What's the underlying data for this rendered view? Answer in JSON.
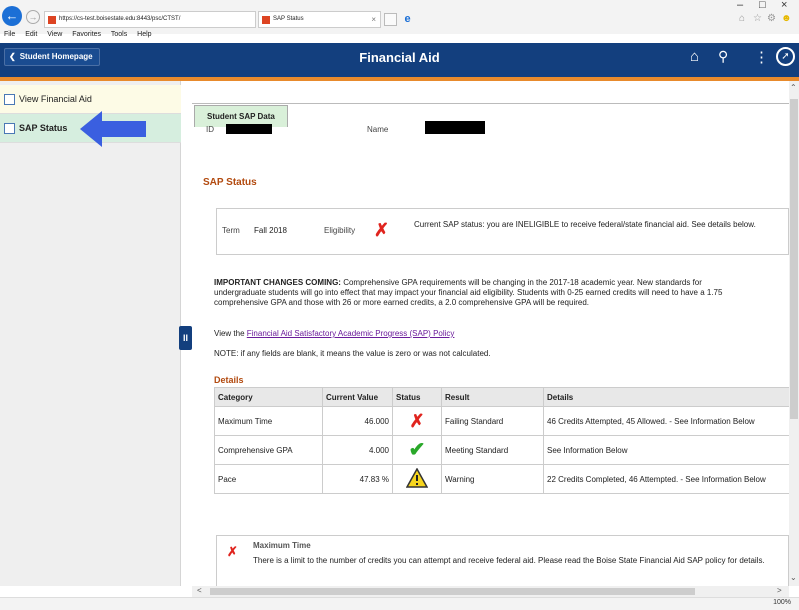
{
  "browser": {
    "address": "https://cs-test.boisestate.edu:8443/psc/CTST/",
    "tab_title": "SAP Status",
    "menu": [
      "File",
      "Edit",
      "View",
      "Favorites",
      "Tools",
      "Help"
    ],
    "zoom": "100%"
  },
  "header": {
    "home_label": "Student Homepage",
    "title": "Financial Aid",
    "icons": [
      "home-icon",
      "search-icon",
      "more-options-icon",
      "navbar-icon"
    ],
    "accent_color": "#133f7e",
    "stripe_color": "#e88a2c"
  },
  "sidebar": {
    "items": [
      {
        "label": "View Financial Aid",
        "selected": false
      },
      {
        "label": "SAP Status",
        "selected": true
      }
    ]
  },
  "content": {
    "tab_label": "Student SAP Data",
    "id_label": "ID",
    "name_label": "Name",
    "sap_heading": "SAP Status",
    "term_label": "Term",
    "term_value": "Fall 2018",
    "eligibility_label": "Eligibility",
    "status_message": "Current SAP status: you are INELIGIBLE to receive federal/state financial aid.   See details below.",
    "changes_bold": "IMPORTANT CHANGES COMING:",
    "changes_text": " Comprehensive GPA requirements will be changing in the 2017-18 academic year. New standards for undergraduate students will go into effect that may impact your financial aid eligibility. Students with 0-25 earned credits will need to have a 1.75 comprehensive GPA and those with 26 or more earned credits, a 2.0 comprehensive GPA will be required.",
    "policy_prefix": "View the ",
    "policy_link": "Financial Aid Satisfactory Academic Progress (SAP) Policy",
    "note": "NOTE: if any fields are blank, it means the value is zero or was not calculated.",
    "details_heading": "Details",
    "table": {
      "headers": [
        "Category",
        "Current Value",
        "Status",
        "Result",
        "Details"
      ],
      "rows": [
        {
          "category": "Maximum Time",
          "value": "46.000",
          "status": "fail",
          "result": "Failing Standard",
          "details": "46 Credits Attempted, 45 Allowed. - See Information Below"
        },
        {
          "category": "Comprehensive GPA",
          "value": "4.000",
          "status": "pass",
          "result": "Meeting Standard",
          "details": "See Information Below"
        },
        {
          "category": "Pace",
          "value": "47.83 %",
          "status": "warning",
          "result": "Warning",
          "details": "22 Credits Completed, 46 Attempted. - See Information Below"
        }
      ]
    },
    "info_title": "Maximum Time",
    "info_text": "There is a limit to the number of credits you can attempt and receive federal aid.   Please read the Boise State Financial Aid SAP policy for details."
  }
}
